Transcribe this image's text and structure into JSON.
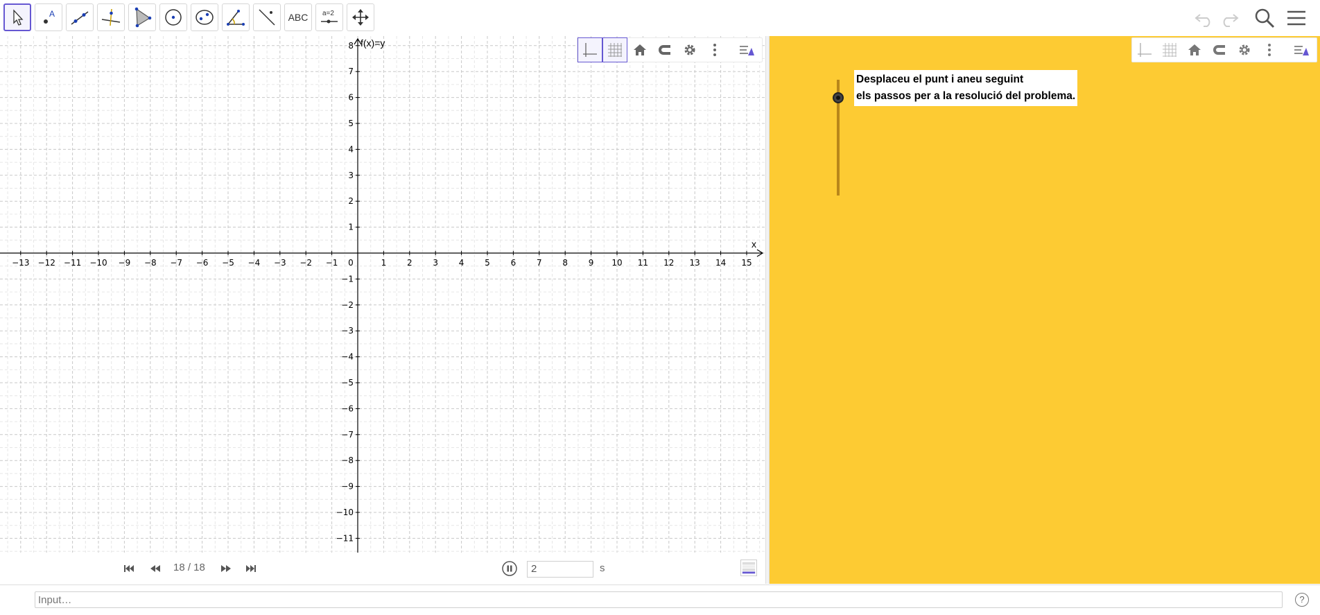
{
  "toolbar": {
    "tools": [
      {
        "name": "move-tool",
        "label": ""
      },
      {
        "name": "point-tool",
        "label": ""
      },
      {
        "name": "line-tool",
        "label": ""
      },
      {
        "name": "perpendicular-tool",
        "label": ""
      },
      {
        "name": "polygon-tool",
        "label": ""
      },
      {
        "name": "circle-tool",
        "label": ""
      },
      {
        "name": "ellipse-tool",
        "label": ""
      },
      {
        "name": "angle-tool",
        "label": ""
      },
      {
        "name": "reflect-tool",
        "label": ""
      },
      {
        "name": "text-tool",
        "label": "ABC"
      },
      {
        "name": "slider-tool",
        "label": "a = 2"
      },
      {
        "name": "move-graphics-tool",
        "label": ""
      }
    ],
    "right_icons": [
      "undo-icon",
      "redo-icon",
      "search-icon",
      "menu-icon"
    ]
  },
  "graphics1": {
    "x_ticks": [
      "−13",
      "−12",
      "−11",
      "−10",
      "−9",
      "−8",
      "−7",
      "−6",
      "−5",
      "−4",
      "−3",
      "−2",
      "−1",
      "0",
      "1",
      "2",
      "3",
      "4",
      "5",
      "6",
      "7",
      "8",
      "9",
      "10",
      "11",
      "12",
      "13",
      "14",
      "15"
    ],
    "y_ticks_pos": [
      "8",
      "7",
      "6",
      "5",
      "4",
      "3",
      "2",
      "1"
    ],
    "y_ticks_neg": [
      "−1",
      "−2",
      "−3",
      "−4",
      "−5",
      "−6",
      "−7",
      "−8",
      "−9",
      "−10",
      "−11"
    ],
    "x_axis_label": "x",
    "function_label": "f(x)=y"
  },
  "graphics2": {
    "message_line1": "Desplaceu el punt i aneu seguint",
    "message_line2": "els passos per a la resolució del problema."
  },
  "player": {
    "step_counter": "18 / 18",
    "speed_value": "2",
    "speed_unit": "s"
  },
  "input": {
    "placeholder": "Input…",
    "help_label": "?"
  },
  "colors": {
    "accent": "#6557d2",
    "graphics2_bg": "#fdcb33",
    "slider_line": "#b8861a"
  }
}
